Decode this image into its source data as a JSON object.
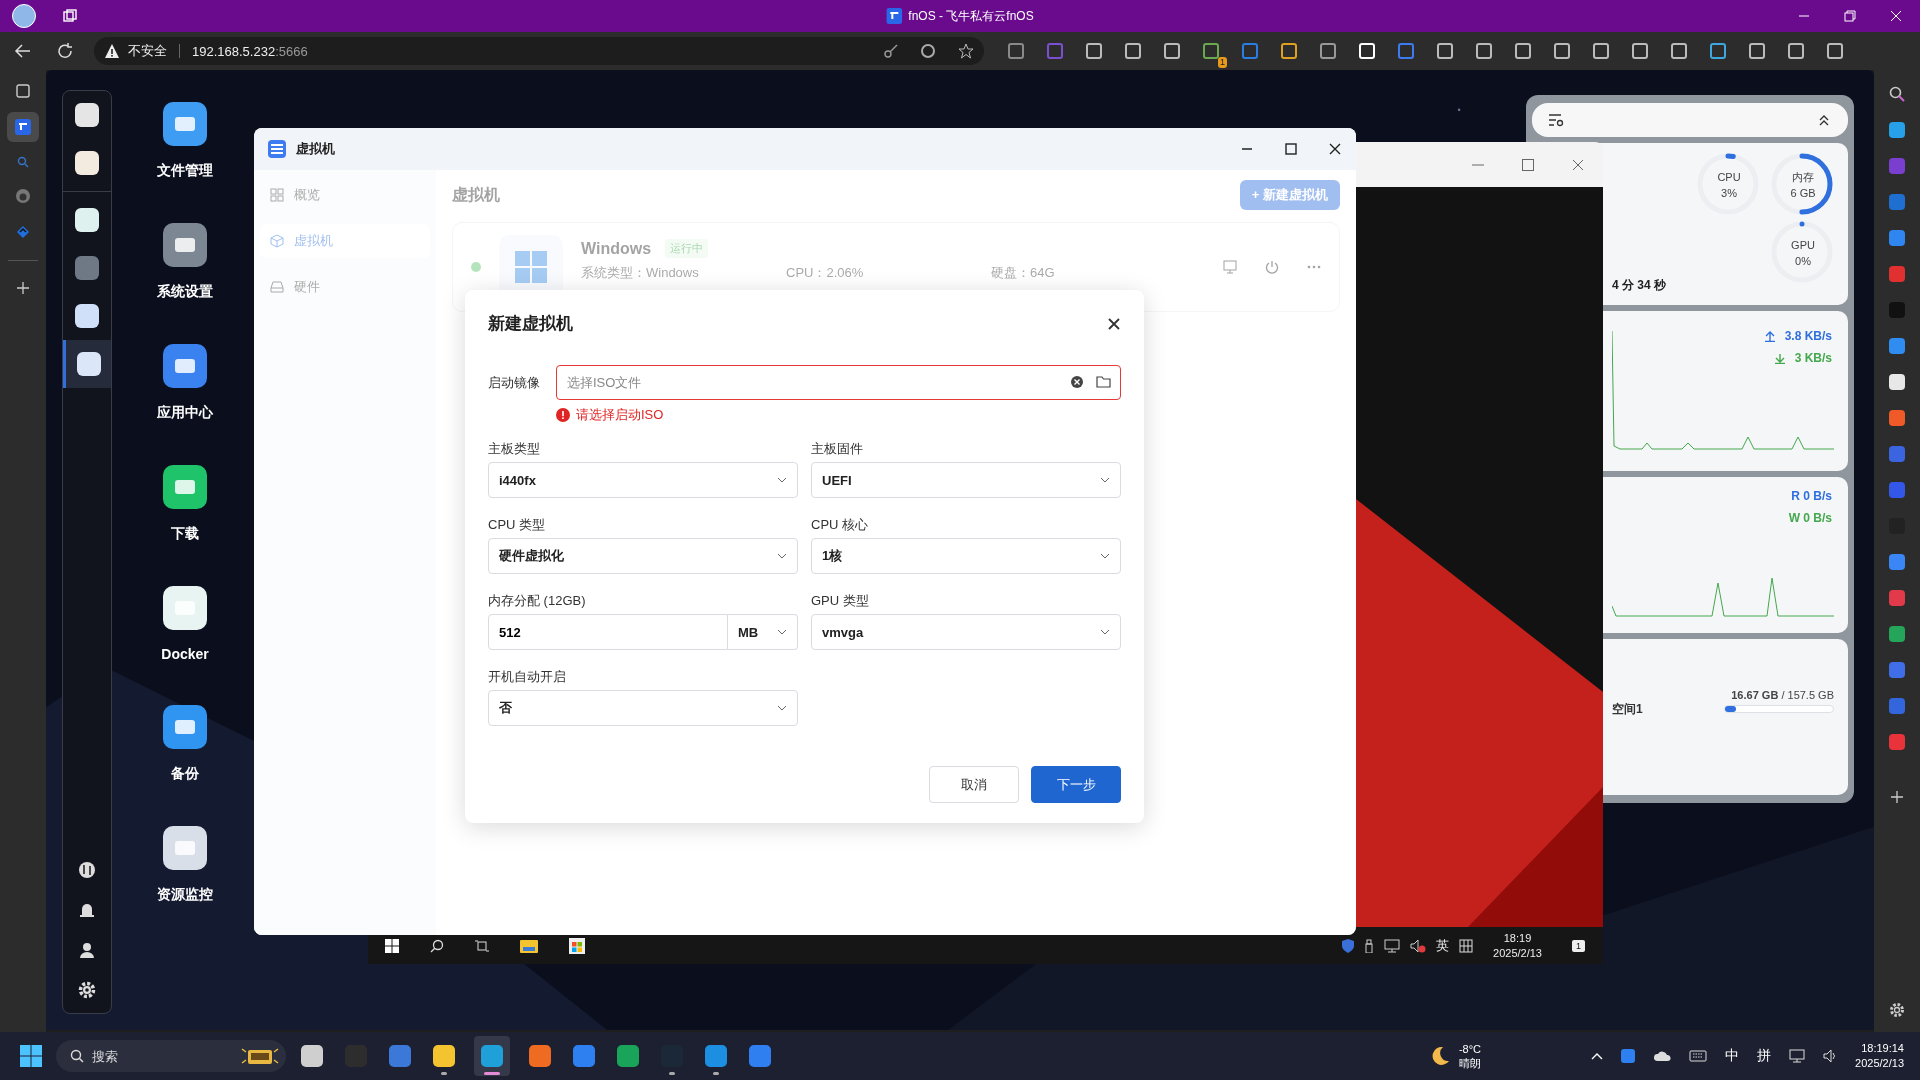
{
  "browser": {
    "title": "fnOS - 飞牛私有云fnOS",
    "security": "不安全",
    "url_host": "192.168.5.232",
    "url_port": ":5666",
    "extension_badge": "1"
  },
  "dock": {
    "top": [
      {
        "kind": "monitor",
        "selected": false
      },
      {
        "kind": "apps",
        "selected": false
      }
    ],
    "apps": [
      {
        "kind": "docker",
        "selected": false
      },
      {
        "kind": "settings",
        "selected": false
      },
      {
        "kind": "screen",
        "selected": false
      },
      {
        "kind": "vm",
        "selected": true
      }
    ]
  },
  "desktop_icons": [
    {
      "label": "文件管理",
      "kind": "folder"
    },
    {
      "label": "系统设置",
      "kind": "settings"
    },
    {
      "label": "应用中心",
      "kind": "store"
    },
    {
      "label": "下载",
      "kind": "download"
    },
    {
      "label": "Docker",
      "kind": "docker"
    },
    {
      "label": "备份",
      "kind": "backup"
    },
    {
      "label": "资源监控",
      "kind": "monitor"
    }
  ],
  "vm_window": {
    "title": "虚拟机",
    "nav": [
      {
        "label": "概览",
        "kind": "grid",
        "selected": false
      },
      {
        "label": "虚拟机",
        "kind": "cube",
        "selected": true
      },
      {
        "label": "硬件",
        "kind": "disk",
        "selected": false
      }
    ],
    "heading": "虚拟机",
    "new_button": "+ 新建虚拟机",
    "vm": {
      "name": "Windows",
      "status": "运行中",
      "running": true,
      "fields": [
        "系统类型：Windows",
        "CPU：2.06%",
        "硬盘：64G"
      ]
    }
  },
  "dialog": {
    "title": "新建虚拟机",
    "iso": {
      "label": "启动镜像",
      "placeholder": "选择ISO文件",
      "error": "请选择启动ISO"
    },
    "fields": [
      {
        "label": "主板类型",
        "value": "i440fx",
        "kind": "select"
      },
      {
        "label": "主板固件",
        "value": "UEFI",
        "kind": "select"
      },
      {
        "label": "CPU 类型",
        "value": "硬件虚拟化",
        "kind": "select"
      },
      {
        "label": "CPU 核心",
        "value": "1核",
        "kind": "select"
      },
      {
        "label": "内存分配 (12GB)",
        "value": "512",
        "unit": "MB",
        "kind": "unit-input"
      },
      {
        "label": "GPU 类型",
        "value": "vmvga",
        "kind": "select"
      },
      {
        "label": "开机自动开启",
        "value": "否",
        "kind": "select"
      }
    ],
    "cancel": "取消",
    "next": "下一步"
  },
  "remote_window": {
    "ime": "英",
    "time": "18:19",
    "date": "2025/2/13",
    "notifications": "1"
  },
  "widget": {
    "gauges": [
      {
        "label": "CPU",
        "value": "3%",
        "level": 0.03
      },
      {
        "label": "内存",
        "value": "6 GB",
        "level": 0.5
      },
      {
        "label": "GPU",
        "value": "0%",
        "level": 0
      }
    ],
    "uptime": "4 分 34 秒",
    "upload": "3.8 KB/s",
    "download": "3 KB/s",
    "read": "R  0 B/s",
    "write": "W  0 B/s",
    "volume": "空间1",
    "used": "16.67 GB",
    "total": "/ 157.5 GB",
    "level": 0.106
  },
  "taskbar": {
    "search_placeholder": "搜索",
    "apps": [
      {
        "kind": "window",
        "running": false,
        "selected": false
      },
      {
        "kind": "terminal",
        "running": false,
        "selected": false
      },
      {
        "kind": "remote",
        "running": false,
        "selected": false
      },
      {
        "kind": "folder",
        "running": true,
        "selected": false
      },
      {
        "kind": "edge",
        "running": true,
        "selected": true
      },
      {
        "kind": "firefox",
        "running": false,
        "selected": false
      },
      {
        "kind": "clock",
        "running": false,
        "selected": false
      },
      {
        "kind": "play",
        "running": false,
        "selected": false
      },
      {
        "kind": "steam",
        "running": true,
        "selected": false
      },
      {
        "kind": "share",
        "running": true,
        "selected": false
      },
      {
        "kind": "note",
        "running": false,
        "selected": false
      }
    ],
    "temperature": "-8°C",
    "weather": "晴朗",
    "ime": "中",
    "ime_mode": "拼",
    "time": "18:19:14",
    "date": "2025/2/13"
  }
}
